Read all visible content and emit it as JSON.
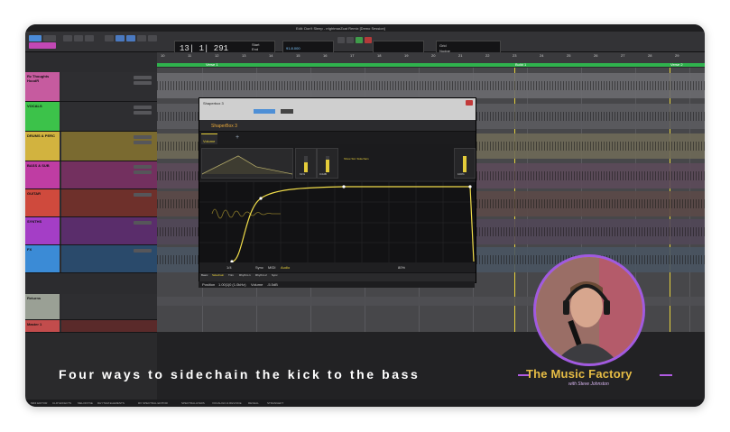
{
  "window": {
    "title": "Edit: Don't Sleep - rrlghtmarZcat Remix [Demo Session]"
  },
  "transport": {
    "counter": "13| 1| 291",
    "start_label": "Start",
    "end_label": "End",
    "length_label": "Length",
    "bpm": "91.8.000",
    "grid_label": "Grid",
    "nudge_label": "Nudge"
  },
  "rulers": {
    "markers": [
      "Verse 1",
      "Build 1",
      "Verse 2"
    ],
    "bar_numbers": [
      "10",
      "11",
      "12",
      "13",
      "14",
      "15",
      "16",
      "17",
      "18",
      "19",
      "20",
      "21",
      "22",
      "23",
      "24",
      "25",
      "26",
      "27",
      "28",
      "29"
    ]
  },
  "tracks": [
    {
      "name": "Rz Thoughts HoodR",
      "color": "#c65b9f"
    },
    {
      "name": "VOCALS",
      "color": "#3cc24a"
    },
    {
      "name": "DRUMS & PERC",
      "color": "#d2b33f"
    },
    {
      "name": "BASS & SUB",
      "color": "#bf3da3"
    },
    {
      "name": "GUITAR",
      "color": "#cf4a3d"
    },
    {
      "name": "SYNTHS",
      "color": "#a43ec6"
    },
    {
      "name": "FX",
      "color": "#3b8bd6"
    },
    {
      "name": "Returns",
      "color": "#9aa095"
    },
    {
      "name": "Master 1",
      "color": "#c24c4c"
    }
  ],
  "plugin": {
    "name": "ShaperBox 3",
    "insert_label": "Shaperbox 3",
    "tab_volume": "Volume",
    "tabs_bottom": [
      "Basic",
      "Sidechain",
      "Trim",
      "Rhythm 1",
      "Rhythm 2",
      "Sync"
    ],
    "percent_left": "61%",
    "value_left": "0.0dB",
    "percent_right": "100%",
    "show_sidechain": "Show Sid. Sidechain",
    "sync_label": "Sync",
    "midi_label": "MIDI",
    "audio_label": "Audio",
    "division": "1/4",
    "mix": "80%"
  },
  "position": {
    "label": "Position",
    "value": "1.00|1|0 (1.0kHz)",
    "volume_label": "Volume",
    "volume_value": "-5.5dB"
  },
  "caption": "Four ways to sidechain the kick to the bass",
  "brand": {
    "name": "The Music Factory",
    "tagline": "with Steve Johnston"
  },
  "statusbar": {
    "items": [
      "MIDI EDITOR",
      "CLIP EFFECTS",
      "MELODYNE",
      "RHYTHM ELEMENTS",
      "RX SPECTRAL EDITOR",
      "SPECTRALAYERS",
      "VOCALIGN & REVOICE",
      "REVEAL",
      "STRANGEFT"
    ]
  },
  "colors": {
    "accent_yellow": "#e6cf3b",
    "brand_purple": "#a15ae0",
    "brand_gold": "#e7bd45",
    "marker_green": "#2fb24d"
  }
}
